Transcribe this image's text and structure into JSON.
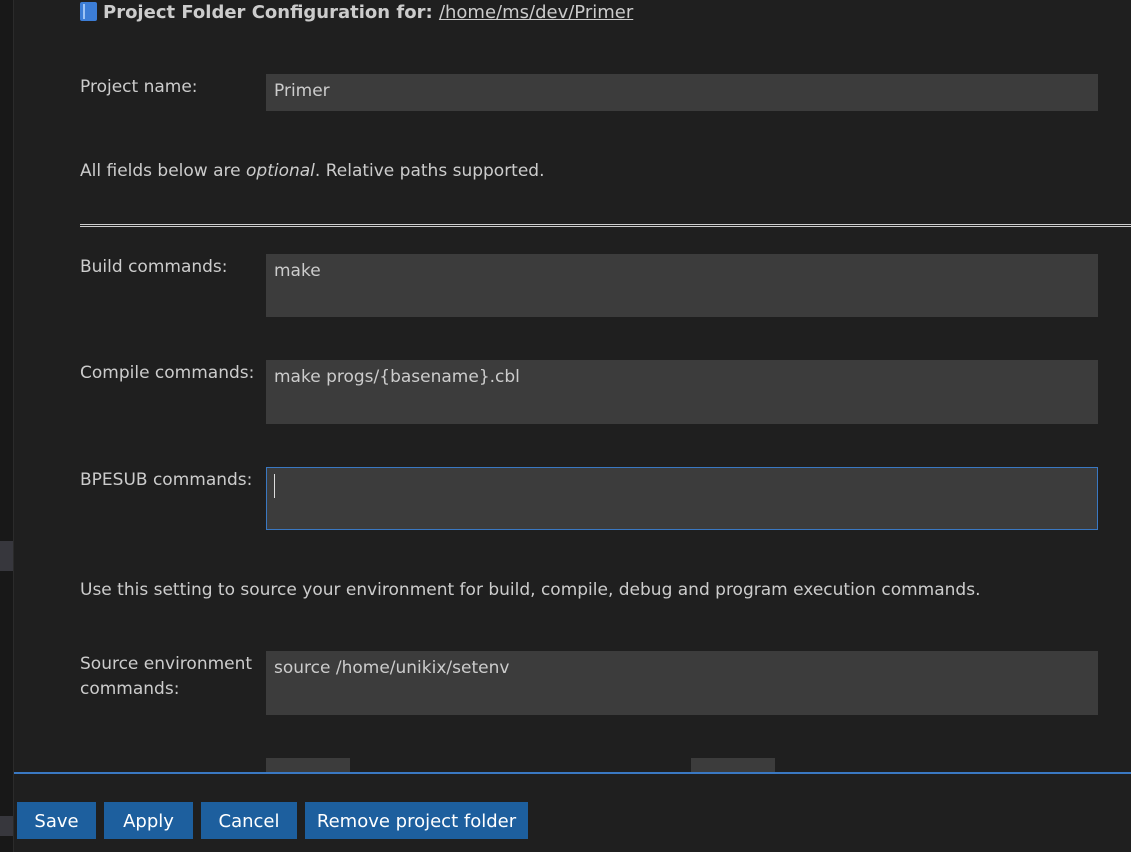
{
  "header": {
    "icon": "book-icon",
    "title": "Project Folder Configuration for:",
    "path": "/home/ms/dev/Primer"
  },
  "project_name": {
    "label": "Project name:",
    "value": "Primer"
  },
  "optional_note": {
    "prefix": "All fields below are ",
    "emphasis": "optional",
    "suffix": ". Relative paths supported."
  },
  "build": {
    "label": "Build commands:",
    "value": "make"
  },
  "compile": {
    "label": "Compile commands:",
    "value": "make progs/{basename}.cbl"
  },
  "bpesub": {
    "label": "BPESUB commands:",
    "value": ""
  },
  "env_note": "Use this setting to source your environment for build, compile, debug and program execution commands.",
  "source_env": {
    "label_line1": "Source environment",
    "label_line2": "commands:",
    "value": "source /home/unikix/setenv"
  },
  "buttons": {
    "save": "Save",
    "apply": "Apply",
    "cancel": "Cancel",
    "remove": "Remove project folder"
  },
  "colors": {
    "background": "#1f1f1f",
    "input_background": "#3c3c3c",
    "button": "#1d5f9e",
    "focus_border": "#3a78c2"
  }
}
